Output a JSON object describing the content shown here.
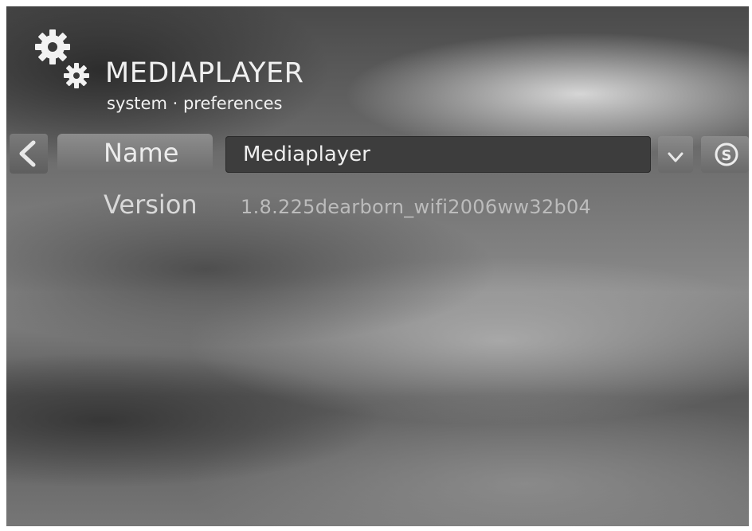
{
  "header": {
    "title": "MEDIAPLAYER",
    "subtitle": "system · preferences",
    "logo_icon": "gears-icon"
  },
  "navigation": {
    "back_icon": "chevron-left-icon"
  },
  "fields": {
    "name": {
      "label": "Name",
      "value": "Mediaplayer",
      "dropdown_icon": "chevron-down-icon",
      "action_icon": "circled-s-icon"
    },
    "version": {
      "label": "Version",
      "value": "1.8.225dearborn_wifi2006ww32b04"
    }
  },
  "colors": {
    "text": "#ececec",
    "field_bg": "#3d3d3d",
    "tab_bg": "#7f7f7f"
  }
}
